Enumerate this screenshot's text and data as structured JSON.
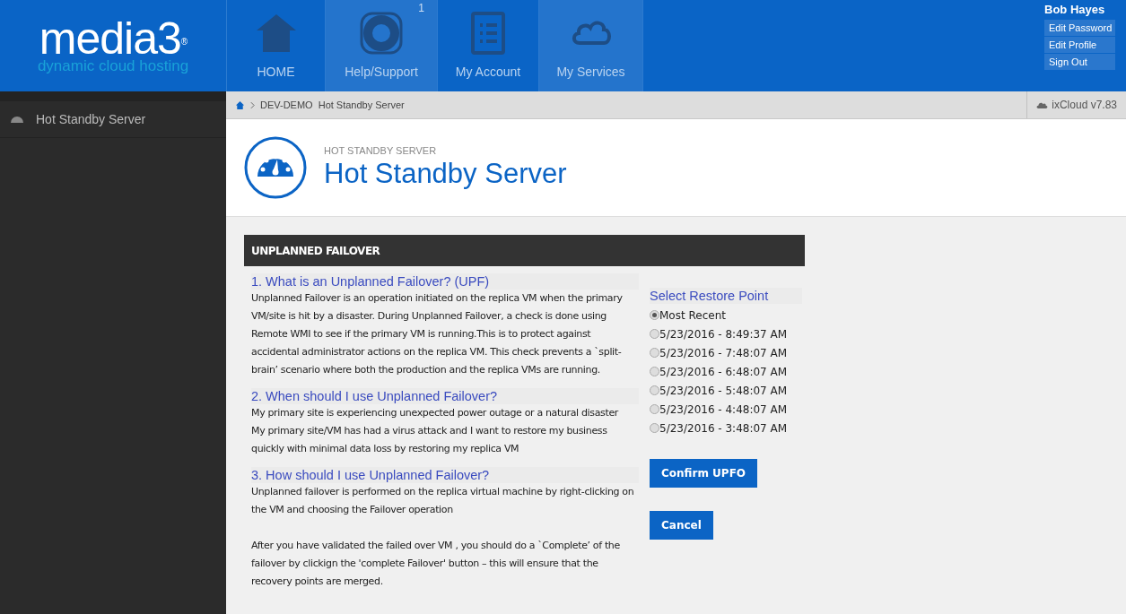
{
  "logo": {
    "name": "media3",
    "mark": "®",
    "tagline": "dynamic cloud hosting"
  },
  "nav": [
    {
      "label": "HOME",
      "highlighted": false
    },
    {
      "label": "Help/Support",
      "highlighted": true,
      "badge": "1"
    },
    {
      "label": "My Account",
      "highlighted": false
    },
    {
      "label": "My Services",
      "highlighted": true
    }
  ],
  "user": {
    "name": "Bob Hayes",
    "links": [
      "Edit Password",
      "Edit Profile",
      "Sign Out"
    ]
  },
  "sidebar": {
    "items": [
      {
        "label": "Hot Standby Server",
        "selected": false
      }
    ]
  },
  "breadcrumb": [
    "DEV-DEMO",
    "Hot Standby Server"
  ],
  "version": "ixCloud v7.83",
  "page": {
    "kicker": "HOT STANDBY SERVER",
    "title": "Hot Standby Server"
  },
  "panel": {
    "title": "UNPLANNED FAILOVER",
    "sections": [
      {
        "heading": "1. What is an Unplanned Failover? (UPF)",
        "paragraphs": [
          "Unplanned Failover is an operation initiated on the replica VM when the primary VM/site is hit by a disaster. During Unplanned Failover, a check is done using Remote WMI to see if the primary VM is running.This is to protect against accidental administrator actions on the replica VM. This check prevents a `split-brain’ scenario where both the production and the replica VMs are running."
        ]
      },
      {
        "heading": "2. When should I use Unplanned Failover?",
        "paragraphs": [
          "My primary site is experiencing unexpected power outage or a natural disaster",
          "My primary site/VM has had a virus attack and I want to restore my business quickly with minimal data loss by restoring my replica VM"
        ]
      },
      {
        "heading": "3. How should I use Unplanned Failover?",
        "paragraphs": [
          "Unplanned failover is performed on the replica virtual machine by right-clicking on the VM and choosing the Failover operation",
          "After you have validated the failed over VM , you should do a `Complete’ of the failover by clickign the 'complete Failover' button – this will ensure that the recovery points are merged."
        ]
      }
    ],
    "restore": {
      "heading": "Select Restore Point",
      "options": [
        {
          "label": "Most Recent",
          "selected": true
        },
        {
          "label": "5/23/2016 - 8:49:37 AM",
          "selected": false
        },
        {
          "label": "5/23/2016 - 7:48:07 AM",
          "selected": false
        },
        {
          "label": "5/23/2016 - 6:48:07 AM",
          "selected": false
        },
        {
          "label": "5/23/2016 - 5:48:07 AM",
          "selected": false
        },
        {
          "label": "5/23/2016 - 4:48:07 AM",
          "selected": false
        },
        {
          "label": "5/23/2016 - 3:48:07 AM",
          "selected": false
        }
      ]
    },
    "buttons": [
      "Confirm UPFO",
      "Cancel"
    ]
  }
}
